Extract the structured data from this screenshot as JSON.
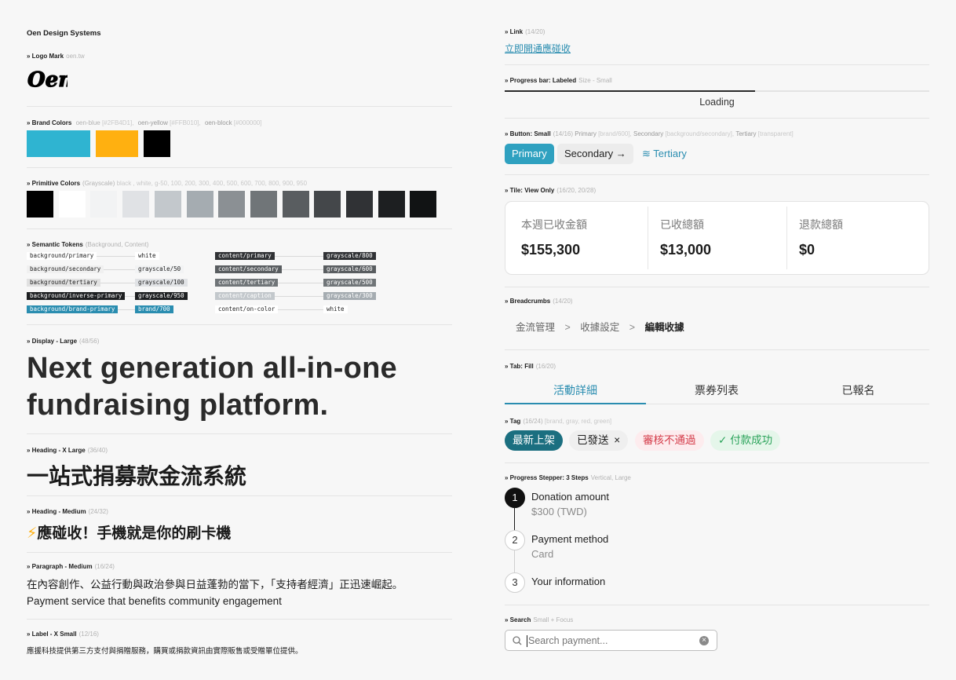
{
  "left": {
    "app_title": "Oen Design Systems",
    "logo_mark": {
      "label": "» Logo Mark",
      "meta": "oen.tw",
      "logo_text": "Oen"
    },
    "brand_colors": {
      "label": "» Brand Colors",
      "meta_parts": [
        "oen-blue",
        "[#2FB4D1],",
        "oen-yellow",
        "[#FFB010],",
        "oen-block",
        "[#000000]"
      ],
      "colors": [
        "#2FB4D1",
        "#FFB010",
        "#000000"
      ]
    },
    "primitive_colors": {
      "label": "» Primitive Colors",
      "meta": "(Grayscale)",
      "meta2": "black , white, g-50, 100, 200, 300, 400, 500, 600, 700, 800, 900, 950",
      "colors": [
        "#000000",
        "#ffffff",
        "#f2f3f4",
        "#e0e2e5",
        "#c3c8cc",
        "#a5acb1",
        "#8b9094",
        "#707578",
        "#595d60",
        "#44474a",
        "#303235",
        "#1d1f21",
        "#111314"
      ]
    },
    "semantic_tokens": {
      "label": "» Semantic Tokens",
      "meta": "(Background, Content)",
      "background": [
        {
          "name": "background/primary",
          "value": "white"
        },
        {
          "name": "background/secondary",
          "value": "grayscale/50"
        },
        {
          "name": "background/tertiary",
          "value": "grayscale/100"
        },
        {
          "name": "background/inverse-primary",
          "value": "grayscale/950"
        },
        {
          "name": "background/brand-primary",
          "value": "brand/700"
        }
      ],
      "content": [
        {
          "name": "content/primary",
          "value": "grayscale/800"
        },
        {
          "name": "content/secondary",
          "value": "grayscale/600"
        },
        {
          "name": "content/tertiary",
          "value": "grayscale/500"
        },
        {
          "name": "content/caption",
          "value": "grayscale/300"
        },
        {
          "name": "content/on-color",
          "value": "white"
        }
      ]
    },
    "display_large": {
      "label": "» Display - Large",
      "meta": "(48/56)",
      "line1": "Next generation all-in-one",
      "line2": "fundraising platform."
    },
    "heading_xl": {
      "label": "» Heading - X Large",
      "meta": "(36/40)",
      "text": "一站式捐募款金流系統"
    },
    "heading_md": {
      "label": "» Heading - Medium",
      "meta": "(24/32)",
      "icon": "⚡",
      "text": "應碰收！手機就是你的刷卡機"
    },
    "paragraph_md": {
      "label": "» Paragraph - Medium",
      "meta": "(16/24)",
      "line1": "在內容創作、公益行動與政治參與日益蓬勃的當下，「支持者經濟」正迅速崛起。",
      "line2": "Payment service that benefits community engagement"
    },
    "label_xs": {
      "label": "» Label - X Small",
      "meta": "(12/16)",
      "text": "應援科技提供第三方支付與捐贈服務，購買或捐款資訊由實際販售或受贈單位提供。"
    }
  },
  "right": {
    "link": {
      "label": "» Link",
      "meta": "(14/20)",
      "text": "立即開通應碰收"
    },
    "progress": {
      "label": "» Progress bar: Labeled",
      "meta": "Size - Small",
      "text": "Loading",
      "fraction": 0.59
    },
    "buttons": {
      "label": "» Button: Small",
      "meta": "(14/16)",
      "meta_parts": [
        "Primary",
        "[brand/600],",
        "Secondary",
        "[background/secondary],",
        "Tertiary",
        "[transparent]"
      ],
      "primary": "Primary",
      "secondary": "Secondary →",
      "tertiary_icon": "≋",
      "tertiary": "Tertiary"
    },
    "tile": {
      "label": "» Tile: View Only",
      "meta": "(16/20, 20/28)",
      "items": [
        {
          "label": "本週已收金額",
          "value": "$155,300"
        },
        {
          "label": "已收總額",
          "value": "$13,000"
        },
        {
          "label": "退款總額",
          "value": "$0"
        }
      ]
    },
    "breadcrumbs": {
      "label": "» Breadcrumbs",
      "meta": "(14/20)",
      "items": [
        "金流管理",
        "收據設定",
        "編輯收據"
      ],
      "separator": ">"
    },
    "tabs": {
      "label": "» Tab: Fill",
      "meta": "(16/20)",
      "items": [
        "活動詳細",
        "票券列表",
        "已報名"
      ],
      "active": 0
    },
    "tags": {
      "label": "» Tag",
      "meta": "(16/24)",
      "meta2": "[brand, gray, red, green]",
      "brand": "最新上架",
      "gray": "已發送",
      "gray_close": "×",
      "red": "審核不通過",
      "green_icon": "✓",
      "green": "付款成功"
    },
    "stepper": {
      "label": "» Progress Stepper: 3 Steps",
      "meta": "Vertical, Large",
      "steps": [
        {
          "num": "1",
          "title": "Donation amount",
          "sub": "$300 (TWD)"
        },
        {
          "num": "2",
          "title": "Payment method",
          "sub": "Card"
        },
        {
          "num": "3",
          "title": "Your information",
          "sub": ""
        }
      ]
    },
    "search": {
      "label": "» Search",
      "meta": "Small + Focus",
      "placeholder": "Search payment...",
      "clear_icon": "×"
    }
  },
  "colors": {
    "brand": "#2FA1C0",
    "brand_dark": "#1b6f80",
    "red": "#d43a48",
    "green": "#2aa35a"
  }
}
